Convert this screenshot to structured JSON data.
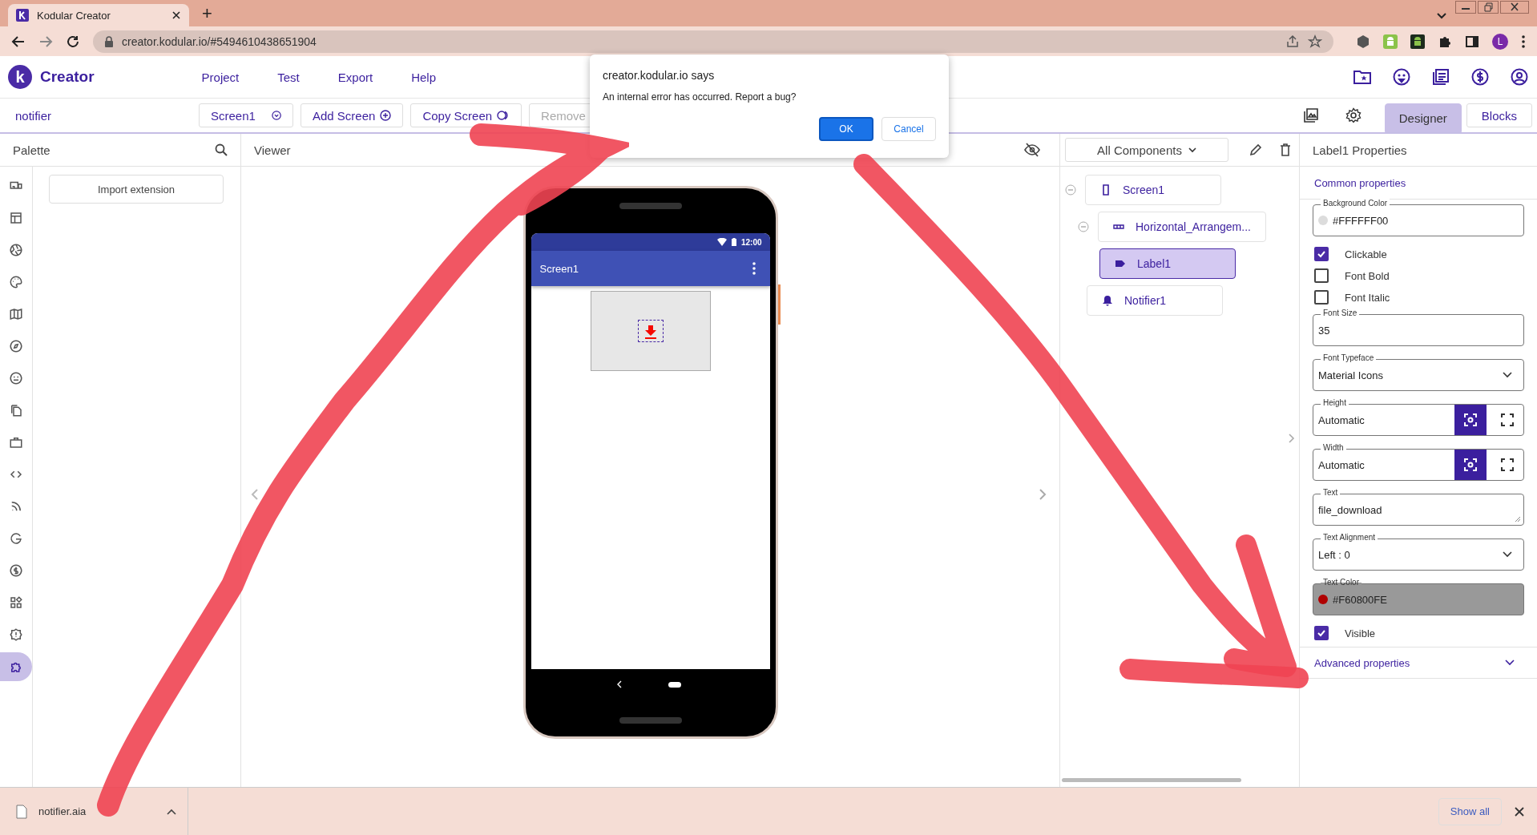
{
  "browser": {
    "tab_title": "Kodular Creator",
    "new_tab": "+",
    "url": "creator.kodular.io/#5494610438651904",
    "profile_initial": "L"
  },
  "app": {
    "logo_letter": "k",
    "name": "Creator",
    "menu": [
      "Project",
      "Test",
      "Export",
      "Help"
    ]
  },
  "toolbar": {
    "project": "notifier",
    "screen_select": "Screen1",
    "add_screen": "Add Screen",
    "copy_screen": "Copy Screen",
    "remove": "Remove",
    "modes": [
      {
        "label": "Designer",
        "selected": true
      },
      {
        "label": "Blocks",
        "selected": false
      }
    ]
  },
  "palette": {
    "title": "Palette",
    "import_button": "Import extension",
    "categories": [
      {
        "selected": false
      },
      {
        "selected": false
      },
      {
        "selected": false
      },
      {
        "selected": false
      },
      {
        "selected": false
      },
      {
        "selected": false
      },
      {
        "selected": false
      },
      {
        "selected": false
      },
      {
        "selected": false
      },
      {
        "selected": false
      },
      {
        "selected": false
      },
      {
        "selected": false
      },
      {
        "selected": false
      },
      {
        "selected": false
      },
      {
        "selected": false
      },
      {
        "selected": true
      }
    ]
  },
  "viewer": {
    "title": "Viewer",
    "phone": {
      "time": "12:00",
      "screen_title": "Screen1"
    }
  },
  "components": {
    "filter": "All Components",
    "tree": [
      {
        "kind": "screen",
        "name": "Screen1",
        "selected": false,
        "expanded": true,
        "children": [
          {
            "kind": "arrangement",
            "name": "Horizontal_Arrangem...",
            "selected": false,
            "expanded": true,
            "children": [
              {
                "kind": "label",
                "name": "Label1",
                "selected": true
              }
            ]
          },
          {
            "kind": "notifier",
            "name": "Notifier1",
            "selected": false
          }
        ]
      }
    ]
  },
  "properties": {
    "title": "Label1 Properties",
    "section": "Common properties",
    "advanced": "Advanced properties",
    "items": [
      {
        "kind": "color",
        "label": "Background Color",
        "value": "#FFFFFF00",
        "color": "#dcdcdc",
        "highlighted": false
      },
      {
        "kind": "checkbox",
        "label": "Clickable",
        "checked": true
      },
      {
        "kind": "checkbox",
        "label": "Font Bold",
        "checked": false
      },
      {
        "kind": "checkbox",
        "label": "Font Italic",
        "checked": false
      },
      {
        "kind": "text",
        "label": "Font Size",
        "value": "35"
      },
      {
        "kind": "select",
        "label": "Font Typeface",
        "value": "Material Icons"
      },
      {
        "kind": "size",
        "label": "Height",
        "value": "Automatic"
      },
      {
        "kind": "size",
        "label": "Width",
        "value": "Automatic"
      },
      {
        "kind": "textarea",
        "label": "Text",
        "value": "file_download"
      },
      {
        "kind": "select",
        "label": "Text Alignment",
        "value": "Left : 0"
      },
      {
        "kind": "color",
        "label": "Text Color",
        "value": "#F60800FE",
        "color": "#b00000",
        "highlighted": true
      },
      {
        "kind": "checkbox",
        "label": "Visible",
        "checked": true
      }
    ]
  },
  "dialog": {
    "title": "creator.kodular.io says",
    "message": "An internal error has occurred. Report a bug?",
    "buttons": [
      {
        "label": "OK",
        "primary": true
      },
      {
        "label": "Cancel",
        "primary": false
      }
    ]
  },
  "downloads": {
    "file": "notifier.aia",
    "show_all": "Show all"
  }
}
